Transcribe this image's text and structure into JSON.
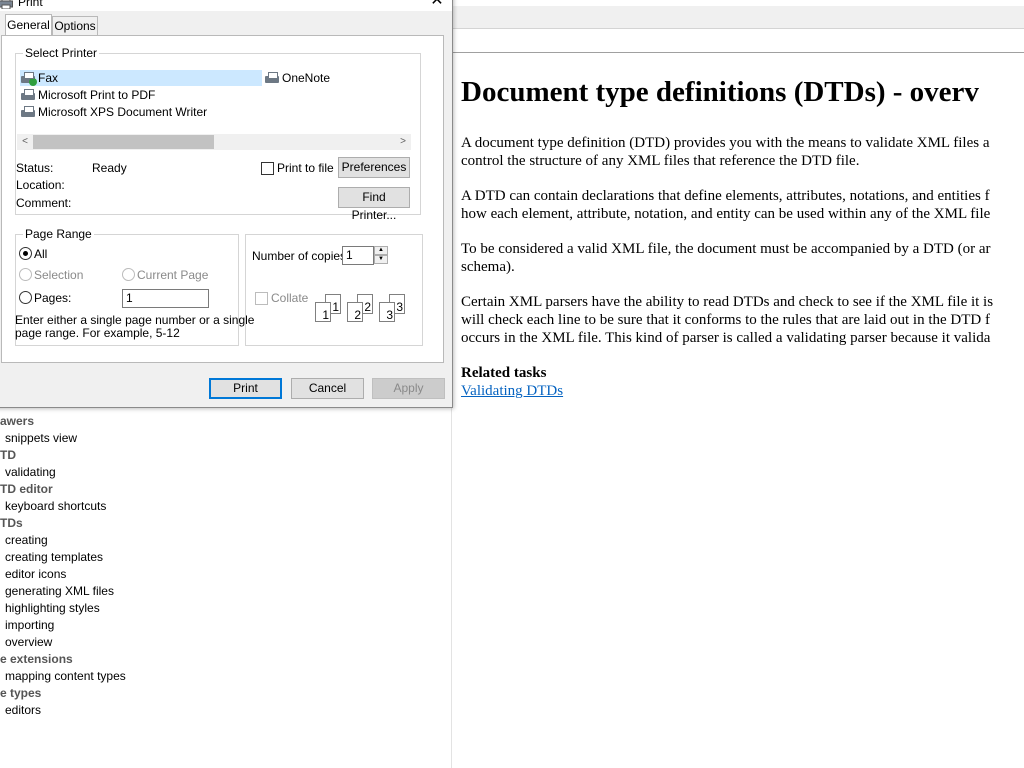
{
  "doc": {
    "title": "Document type definitions (DTDs) - overv",
    "paragraphs": [
      [
        "A document type definition (DTD) provides you with the means to validate XML files a",
        "control the structure of any XML files that reference the DTD file."
      ],
      [
        "A DTD can contain declarations that define elements, attributes, notations, and entities f",
        "how each element, attribute, notation, and entity can be used within any of the XML file"
      ],
      [
        "To be considered a valid XML file, the document must be accompanied by a DTD (or ar",
        "schema)."
      ],
      [
        "Certain XML parsers have the ability to read DTDs and check to see if the XML file it is",
        "will check each line to be sure that it conforms to the rules that are laid out in the DTD f",
        "occurs in the XML file. This kind of parser is called a validating parser because it valida"
      ]
    ],
    "related_title": "Related tasks",
    "related_link": "Validating DTDs"
  },
  "index": [
    {
      "text": "awers",
      "head": true
    },
    {
      "text": "snippets view",
      "head": false
    },
    {
      "text": "TD",
      "head": true
    },
    {
      "text": "validating",
      "head": false
    },
    {
      "text": "TD editor",
      "head": true
    },
    {
      "text": "keyboard shortcuts",
      "head": false
    },
    {
      "text": "TDs",
      "head": true
    },
    {
      "text": "creating",
      "head": false
    },
    {
      "text": "creating templates",
      "head": false
    },
    {
      "text": "editor icons",
      "head": false
    },
    {
      "text": "generating XML files",
      "head": false
    },
    {
      "text": "highlighting styles",
      "head": false
    },
    {
      "text": "importing",
      "head": false
    },
    {
      "text": "overview",
      "head": false
    },
    {
      "text": "e extensions",
      "head": true
    },
    {
      "text": "mapping content types",
      "head": false
    },
    {
      "text": "e types",
      "head": true
    },
    {
      "text": "editors",
      "head": false
    }
  ],
  "dialog": {
    "title": "Print",
    "close": "✕",
    "tabs": [
      "General",
      "Options"
    ],
    "select_printer_label": "Select Printer",
    "printers": [
      "Fax",
      "OneNote",
      "Microsoft Print to PDF",
      "Microsoft XPS Document Writer"
    ],
    "selected_printer": "Fax",
    "scroll_left": "<",
    "scroll_right": ">",
    "status_label": "Status:",
    "status_value": "Ready",
    "location_label": "Location:",
    "comment_label": "Comment:",
    "print_to_file": "Print to file",
    "preferences": "Preferences",
    "find_printer": "Find Printer...",
    "page_range_label": "Page Range",
    "all": "All",
    "selection": "Selection",
    "current_page": "Current Page",
    "pages": "Pages:",
    "pages_value": "1",
    "range_hint_1": "Enter either a single page number or a single",
    "range_hint_2": "page range.  For example, 5-12",
    "copies_label": "Number of copies:",
    "copies_value": "1",
    "collate": "Collate",
    "print_btn": "Print",
    "cancel_btn": "Cancel",
    "apply_btn": "Apply"
  }
}
